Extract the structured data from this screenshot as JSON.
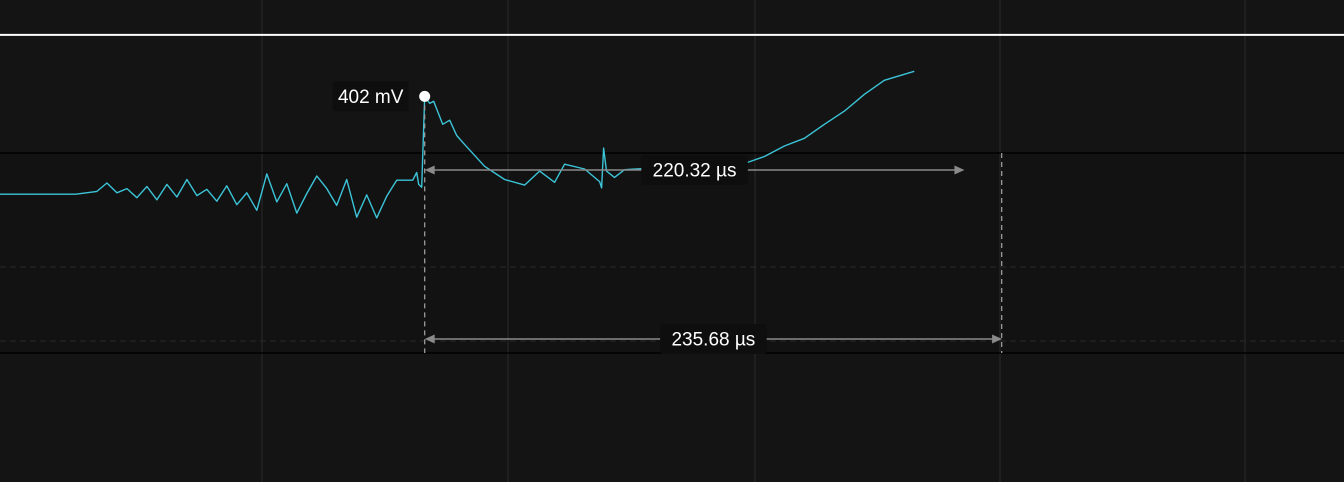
{
  "colors": {
    "background": "#141414",
    "plot_band": "#121212",
    "grid": "#2a2a2a",
    "trace": "#3cc4d8",
    "marker": "#ffffff",
    "measure": "#8a8a8a",
    "label_bg": "#0e0e0e"
  },
  "chart_data": {
    "type": "line",
    "title": "",
    "xlabel": "",
    "ylabel": "",
    "x_unit": "µs",
    "y_unit": "mV",
    "grid": true,
    "trigger_level_mv": 490,
    "xlim": [
      -425,
      920
    ],
    "ylim": [
      -150,
      540
    ],
    "series": [
      {
        "name": "",
        "x": [
          -425,
          -349,
          -328,
          -318,
          -308,
          -298,
          -288,
          -278,
          -268,
          -258,
          -248,
          -238,
          -228,
          -218,
          -208,
          -198,
          -188,
          -178,
          -168,
          -158,
          -148,
          -138,
          -128,
          -118,
          -108,
          -98,
          -88,
          -78,
          -68,
          -58,
          -48,
          -38,
          -28,
          -18,
          -12,
          -8,
          -6,
          -3,
          0,
          5,
          9,
          12,
          18,
          25,
          32,
          40,
          60,
          80,
          100,
          115,
          130,
          140,
          160,
          175,
          177,
          179,
          182,
          190,
          200,
          220,
          240,
          260,
          280,
          300,
          320,
          340,
          360,
          380,
          400,
          420,
          440,
          460,
          490
        ],
        "y": [
          262,
          262,
          266,
          278,
          264,
          270,
          257,
          273,
          254,
          276,
          258,
          283,
          260,
          269,
          252,
          274,
          247,
          264,
          239,
          291,
          251,
          277,
          235,
          263,
          288,
          270,
          246,
          283,
          229,
          261,
          228,
          259,
          282,
          282,
          282,
          293,
          276,
          272,
          402,
          392,
          395,
          384,
          362,
          368,
          346,
          333,
          302,
          283,
          275,
          295,
          279,
          305,
          298,
          280,
          271,
          328,
          295,
          286,
          297,
          299,
          301,
          292,
          304,
          300,
          306,
          316,
          331,
          342,
          362,
          381,
          405,
          425,
          438
        ]
      }
    ]
  },
  "marker": {
    "label": "402 mV",
    "x_us": 0,
    "y_mv": 402
  },
  "measurements": [
    {
      "label": "220.32 µs",
      "start_us": 0,
      "value_us": 220.32
    },
    {
      "label": "235.68 µs",
      "start_us": 0,
      "value_us": 235.68
    }
  ]
}
